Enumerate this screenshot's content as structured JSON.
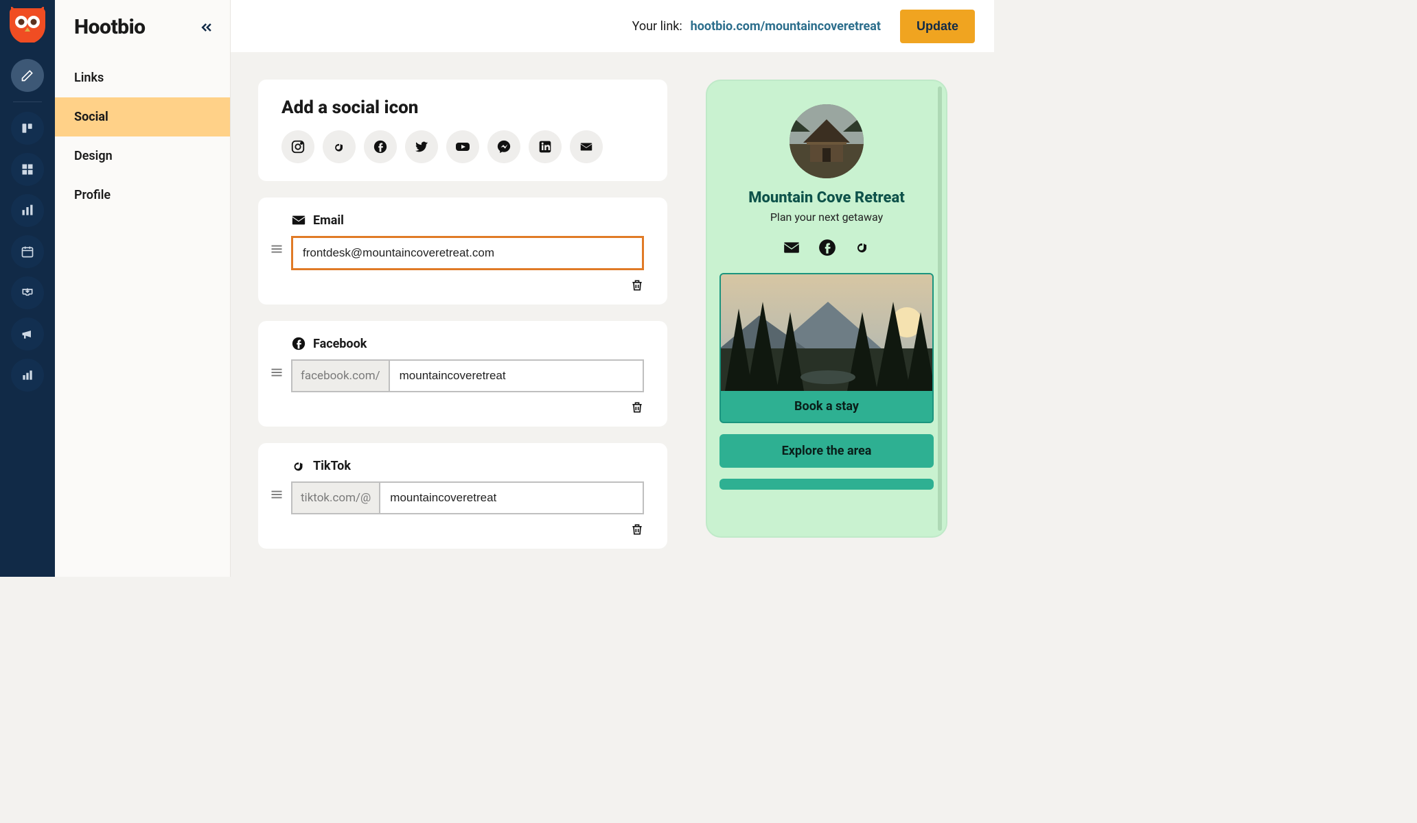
{
  "app": {
    "title": "Hootbio"
  },
  "nav": {
    "items": [
      {
        "label": "Links"
      },
      {
        "label": "Social"
      },
      {
        "label": "Design"
      },
      {
        "label": "Profile"
      }
    ]
  },
  "topbar": {
    "link_label": "Your link:",
    "link_url": "hootbio.com/mountaincoveretreat",
    "update_label": "Update"
  },
  "social_picker": {
    "title": "Add a social icon",
    "options": [
      "instagram",
      "tiktok",
      "facebook",
      "twitter",
      "youtube",
      "messenger",
      "linkedin",
      "email"
    ]
  },
  "entries": {
    "email": {
      "label": "Email",
      "value": "frontdesk@mountaincoveretreat.com"
    },
    "facebook": {
      "label": "Facebook",
      "prefix": "facebook.com/",
      "value": "mountaincoveretreat"
    },
    "tiktok": {
      "label": "TikTok",
      "prefix": "tiktok.com/@",
      "value": "mountaincoveretreat"
    }
  },
  "preview": {
    "name": "Mountain Cove Retreat",
    "tagline": "Plan your next getaway",
    "card1_label": "Book a stay",
    "card2_label": "Explore the area"
  }
}
